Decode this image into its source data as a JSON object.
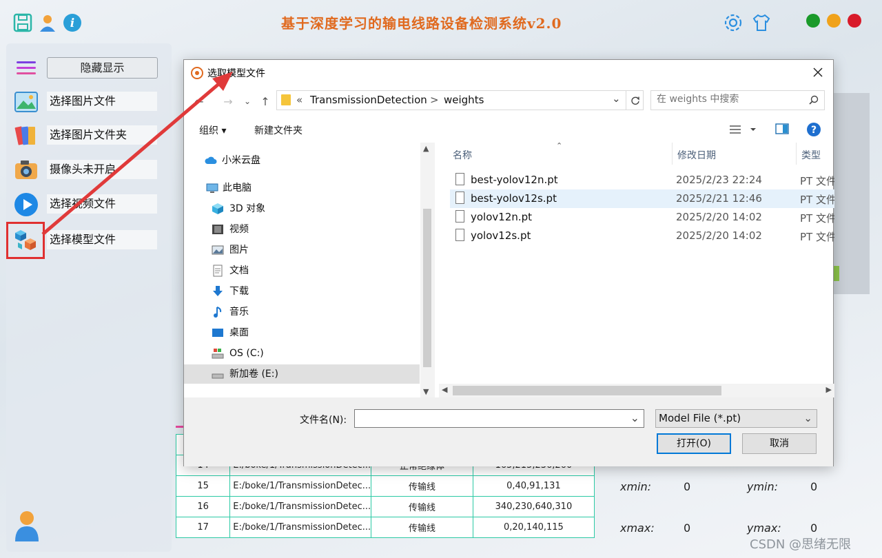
{
  "app": {
    "title": "基于深度学习的输电线路设备检测系统v2.0",
    "accent": "#e06a1f",
    "window_dots": [
      "#1a9a2a",
      "#f0a21a",
      "#d81b2a"
    ]
  },
  "sidebar": {
    "toggle_label": "隐藏显示",
    "items": [
      {
        "label": "选择图片文件",
        "icon": "image-icon"
      },
      {
        "label": "选择图片文件夹",
        "icon": "folder-images-icon"
      },
      {
        "label": "摄像头未开启",
        "icon": "camera-icon"
      },
      {
        "label": "选择视频文件",
        "icon": "video-play-icon"
      },
      {
        "label": "选择模型文件",
        "icon": "model-cube-icon"
      }
    ]
  },
  "table": {
    "rows": [
      {
        "id": "14",
        "path": "E:/boke/1/TransmissionDetec...",
        "cls": "正常绝缘体",
        "box": "165,215,236,260"
      },
      {
        "id": "15",
        "path": "E:/boke/1/TransmissionDetec...",
        "cls": "传输线",
        "box": "0,40,91,131"
      },
      {
        "id": "16",
        "path": "E:/boke/1/TransmissionDetec...",
        "cls": "传输线",
        "box": "340,230,640,310"
      },
      {
        "id": "17",
        "path": "E:/boke/1/TransmissionDetec...",
        "cls": "传输线",
        "box": "0,20,140,115"
      }
    ]
  },
  "coords": {
    "xmin_label": "xmin:",
    "xmin": "0",
    "ymin_label": "ymin:",
    "ymin": "0",
    "xmax_label": "xmax:",
    "xmax": "0",
    "ymax_label": "ymax:",
    "ymax": "0"
  },
  "watermark": "CSDN @思绪无限",
  "dialog": {
    "title": "选取模型文件",
    "breadcrumb": [
      "«",
      "TransmissionDetection",
      ">",
      "weights"
    ],
    "search_placeholder": "在 weights 中搜索",
    "organize": "组织 ▾",
    "new_folder": "新建文件夹",
    "tree": [
      {
        "label": "小米云盘",
        "icon": "cloud-icon"
      },
      {
        "label": "此电脑",
        "icon": "computer-icon"
      },
      {
        "label": "3D 对象",
        "icon": "3d-objects-icon"
      },
      {
        "label": "视频",
        "icon": "videos-folder-icon"
      },
      {
        "label": "图片",
        "icon": "pictures-folder-icon"
      },
      {
        "label": "文档",
        "icon": "documents-folder-icon"
      },
      {
        "label": "下载",
        "icon": "download-icon"
      },
      {
        "label": "音乐",
        "icon": "music-icon"
      },
      {
        "label": "桌面",
        "icon": "desktop-icon"
      },
      {
        "label": "OS (C:)",
        "icon": "drive-c-icon"
      },
      {
        "label": "新加卷 (E:)",
        "icon": "drive-e-icon"
      }
    ],
    "columns": [
      "名称",
      "修改日期",
      "类型"
    ],
    "files": [
      {
        "name": "best-yolov12n.pt",
        "date": "2025/2/23 22:24",
        "type": "PT 文件"
      },
      {
        "name": "best-yolov12s.pt",
        "date": "2025/2/21 12:46",
        "type": "PT 文件"
      },
      {
        "name": "yolov12n.pt",
        "date": "2025/2/20 14:02",
        "type": "PT 文件"
      },
      {
        "name": "yolov12s.pt",
        "date": "2025/2/20 14:02",
        "type": "PT 文件"
      }
    ],
    "filename_label": "文件名(N):",
    "filename_value": "",
    "filter": "Model File (*.pt)",
    "open": "打开(O)",
    "cancel": "取消"
  }
}
